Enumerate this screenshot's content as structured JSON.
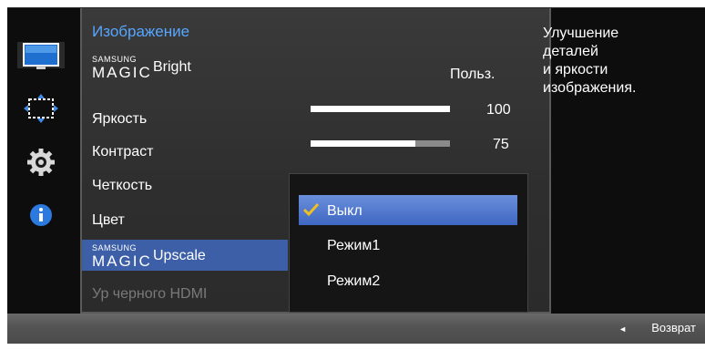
{
  "menu": {
    "title": "Изображение",
    "items": [
      {
        "brand_small": "SAMSUNG",
        "brand_big": "MAGIC",
        "label": "Bright",
        "value": "Польз."
      },
      {
        "label": "Яркость",
        "value": "100",
        "level": 1.0
      },
      {
        "label": "Контраст",
        "value": "75",
        "level": 0.75
      },
      {
        "label": "Четкость"
      },
      {
        "label": "Цвет"
      },
      {
        "brand_small": "SAMSUNG",
        "brand_big": "MAGIC",
        "label": "Upscale"
      },
      {
        "label": "Ур черного HDMI"
      }
    ]
  },
  "dropdown": {
    "options": [
      "Выкл",
      "Режим1",
      "Режим2"
    ],
    "selected": "Выкл"
  },
  "description": {
    "lines": [
      "Улучшение",
      "деталей",
      "и яркости",
      "изображения."
    ]
  },
  "bottom": {
    "back_label": "Возврат"
  },
  "icons": [
    "picture-icon",
    "screen-size-icon",
    "settings-gear-icon",
    "info-icon"
  ],
  "colors": {
    "title": "#56a6ff",
    "selected_row": "#3d5fa8",
    "dropdown_selected": "#5078cf",
    "check": "#f0c020"
  }
}
